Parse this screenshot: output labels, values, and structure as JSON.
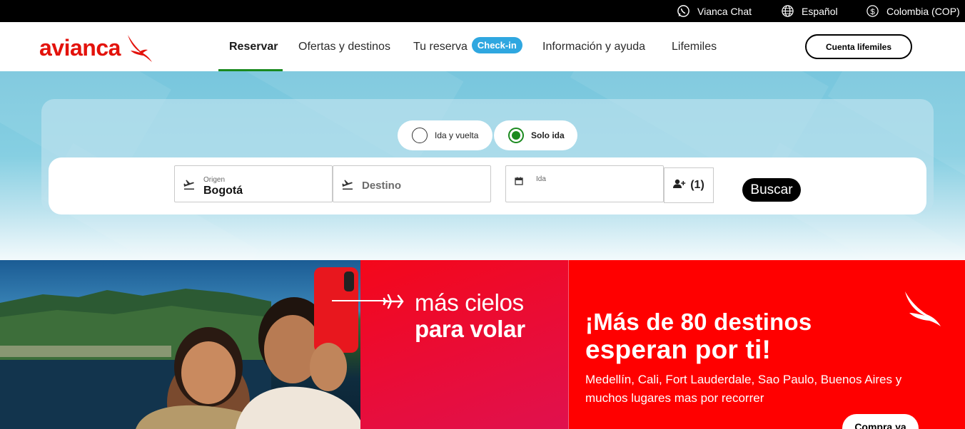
{
  "topbar": {
    "chat_label": "Vianca Chat",
    "language_label": "Español",
    "region_label": "Colombia (COP)"
  },
  "header": {
    "logo_text": "avianca",
    "nav": {
      "reservar": "Reservar",
      "ofertas": "Ofertas y destinos",
      "tu_reserva": "Tu reserva",
      "checkin_badge": "Check-in",
      "informacion": "Información y ayuda",
      "lifemiles": "Lifemiles"
    },
    "account_button": "Cuenta lifemiles"
  },
  "search": {
    "trip_types": [
      "Ida y vuelta",
      "Solo ida"
    ],
    "selected_trip": "Solo ida",
    "origin_label": "Origen",
    "origin_value": "Bogotá",
    "destination_placeholder": "Destino",
    "date_label": "Ida",
    "passengers": "(1)",
    "search_button": "Buscar"
  },
  "banner": {
    "slogan_line1": "más cielos",
    "slogan_line2": "para volar",
    "headline_line1": "¡Más de 80 destinos",
    "headline_line2": "esperan por ti!",
    "subtext": "Medellín, Cali, Fort Lauderdale, Sao Paulo, Buenos Aires y muchos lugares mas por recorrer",
    "cta_button": "Compra ya"
  },
  "colors": {
    "brand_red": "#e3120b",
    "banner_red": "#ff0000",
    "active_green": "#1b8a1f",
    "checkin_blue": "#2fa7e0"
  }
}
